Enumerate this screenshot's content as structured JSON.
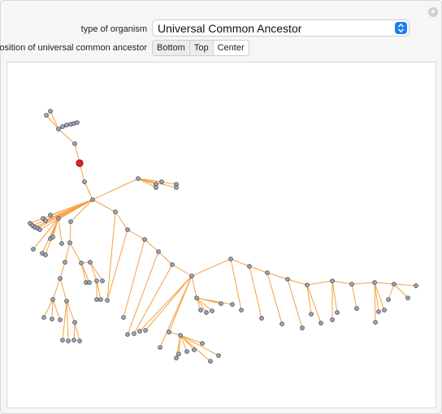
{
  "controls": {
    "organism_label": "type of organism",
    "organism_value": "Universal Common Ancestor",
    "position_label": "position of universal common ancestor",
    "position_options": [
      "Bottom",
      "Top",
      "Center"
    ],
    "position_selected": "Center"
  },
  "colors": {
    "edge": "#f5a040",
    "node_fill": "#9aa7c2",
    "node_stroke": "#444444",
    "root_fill": "#e0261b",
    "accent": "#1f7ff5"
  },
  "icons": {
    "expand": "plus-icon",
    "dropdown": "chevron-updown-icon"
  }
}
